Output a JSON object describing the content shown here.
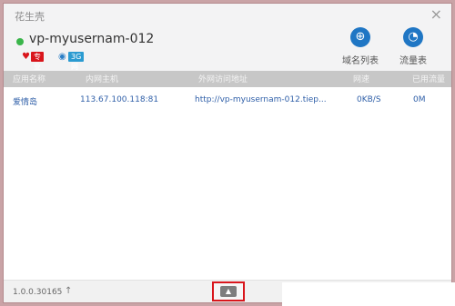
{
  "window": {
    "title": "花生壳",
    "close_glyph": "×"
  },
  "header": {
    "host": "vp-myusernam-012",
    "status_color": "#3ab54a",
    "badge_red": "专业版",
    "badge_blue": "3G网",
    "buttons": [
      {
        "label": "域名列表",
        "icon": "globe-list-icon"
      },
      {
        "label": "流量表",
        "icon": "gauge-icon"
      }
    ]
  },
  "table": {
    "columns": [
      "应用名称",
      "内网主机",
      "外网访问地址",
      "网速",
      "已用流量"
    ],
    "rows": [
      {
        "name": "爱情岛",
        "host": "113.67.100.118:81",
        "url": "http://vp-myusernam-012.tiep...",
        "speed": "0KB/S",
        "used": "0M"
      }
    ]
  },
  "footer": {
    "version": "1.0.0.30165",
    "upgrade_glyph": "↑",
    "expand_glyph": "▲"
  },
  "colors": {
    "accent": "#1f76c4",
    "badge_red": "#d9161c",
    "badge_blue": "#2b9bd1",
    "link": "#2f5fa8"
  }
}
